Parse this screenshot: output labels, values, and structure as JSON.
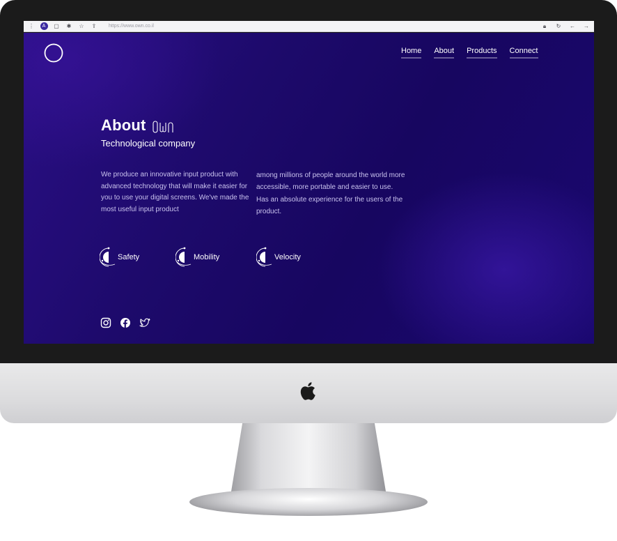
{
  "browser": {
    "url": "https://www.own.co.il",
    "avatar_letter": "A"
  },
  "site": {
    "nav": [
      {
        "label": "Home"
      },
      {
        "label": "About"
      },
      {
        "label": "Products"
      },
      {
        "label": "Connect"
      }
    ],
    "about": {
      "title": "About",
      "brand_mark": "OWN",
      "subtitle": "Technological company",
      "paragraph_left": "We produce an innovative input product with advanced technology that will make it easier for you to use your digital screens. We've made the most useful input product",
      "paragraph_right": "among millions of people around the world more accessible, more portable and easier to use. Has an absolute experience for the users of the product."
    },
    "features": [
      {
        "label": "Safety",
        "icon": "orbit-icon"
      },
      {
        "label": "Mobility",
        "icon": "orbit-icon"
      },
      {
        "label": "Velocity",
        "icon": "orbit-icon"
      }
    ],
    "socials": [
      "instagram-icon",
      "facebook-icon",
      "twitter-icon"
    ]
  },
  "colors": {
    "background": "#1d0a6b",
    "text_muted": "#c9c2ee",
    "frame": "#1b1b1b"
  }
}
